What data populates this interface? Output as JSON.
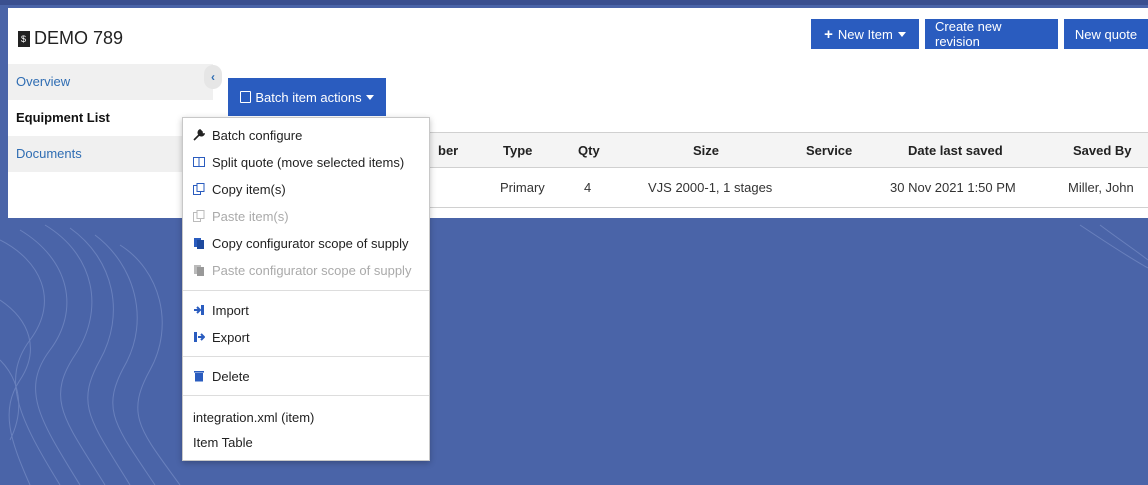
{
  "header": {
    "title": "DEMO 789",
    "new_item_label": "New Item",
    "create_revision_label": "Create new revision",
    "new_quote_label": "New quote"
  },
  "sidebar": {
    "items": [
      {
        "label": "Overview"
      },
      {
        "label": "Equipment List"
      },
      {
        "label": "Documents"
      }
    ]
  },
  "batch": {
    "label": "Batch item actions",
    "menu": [
      {
        "label": "Batch configure",
        "icon": "wrench-icon",
        "enabled": true
      },
      {
        "label": "Split quote (move selected items)",
        "icon": "columns-icon",
        "enabled": true
      },
      {
        "label": "Copy item(s)",
        "icon": "copy-icon",
        "enabled": true
      },
      {
        "label": "Paste item(s)",
        "icon": "paste-icon",
        "enabled": false
      },
      {
        "label": "Copy configurator scope of supply",
        "icon": "copy-scope-icon",
        "enabled": true
      },
      {
        "label": "Paste configurator scope of supply",
        "icon": "paste-scope-icon",
        "enabled": false
      },
      {
        "label": "Import",
        "icon": "import-icon",
        "enabled": true
      },
      {
        "label": "Export",
        "icon": "export-icon",
        "enabled": true
      },
      {
        "label": "Delete",
        "icon": "trash-icon",
        "enabled": true
      },
      {
        "label": "integration.xml (item)",
        "icon": "",
        "enabled": true
      },
      {
        "label": "Item Table",
        "icon": "",
        "enabled": true
      }
    ]
  },
  "table": {
    "columns": [
      "ber",
      "Type",
      "Qty",
      "Size",
      "Service",
      "Date last saved",
      "Saved By"
    ],
    "rows": [
      {
        "type": "Primary",
        "qty": "4",
        "size": "VJS 2000-1, 1 stages",
        "service": "",
        "date": "30 Nov 2021 1:50 PM",
        "saved_by": "Miller, John"
      }
    ]
  },
  "colors": {
    "accent": "#2a5cbf",
    "background": "#4a64a8",
    "link": "#2f6db3"
  }
}
